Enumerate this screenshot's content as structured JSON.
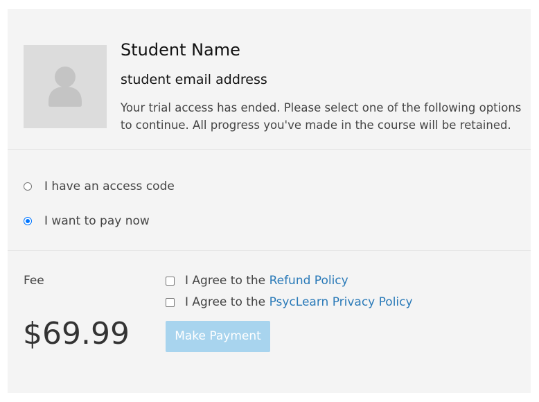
{
  "profile": {
    "name": "Student Name",
    "email": "student email address",
    "message": "Your trial access has ended. Please select one of the following options to continue. All progress you've made in the course will be retained.",
    "avatar_icon": "user-silhouette-icon"
  },
  "options": {
    "access_code_label": "I have an access code",
    "pay_now_label": "I want to pay now",
    "selected": "pay_now"
  },
  "payment": {
    "fee_label": "Fee",
    "price": "$69.99",
    "agreement_prefix": "I Agree to the",
    "refund_policy_link": "Refund Policy",
    "privacy_policy_link": "PsycLearn Privacy Policy",
    "make_payment_label": "Make Payment"
  },
  "colors": {
    "panel_bg": "#f4f4f4",
    "link": "#2a7ab8",
    "radio_selected": "#0075ff",
    "button_disabled_bg": "#a8d4ee"
  }
}
